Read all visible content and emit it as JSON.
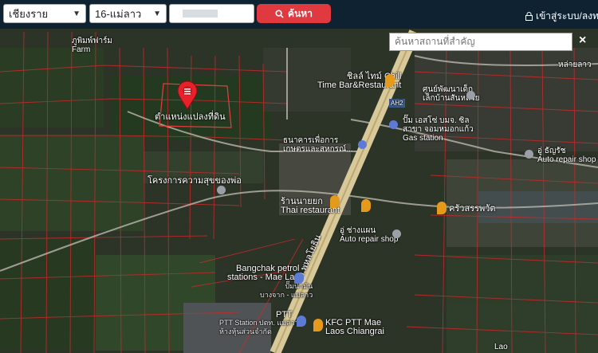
{
  "topbar": {
    "province": "เชียงราย",
    "district": "16-แม่ลาว",
    "parcel_value": "",
    "search_button": "ค้นหา",
    "login_label": "เข้าสู่ระบบ/ลงทะเ"
  },
  "map": {
    "place_search_placeholder": "ค้นหาสถานที่สำคัญ",
    "close_label": "×",
    "marker_label": "ตำแหน่งแปลงที่ดิน",
    "road_code": "AH2",
    "road_name": "ถ.พหลโยธิน",
    "places": [
      {
        "text": "ภูพิมพ์ฟาร์ม",
        "sub": "Farm"
      },
      {
        "text": "ชิลล์ ไทม์ Chill",
        "sub": "Time Bar&Restaurant"
      },
      {
        "text": "หล่ายลาว",
        "sub": ""
      },
      {
        "text": "ศูนย์พัฒนาเด็ก",
        "sub": "เล็กบ้านสันหลวย"
      },
      {
        "text": "ปั๊ม เอสโซ่ บมจ. ซิล",
        "sub": "สาขา จอมหมอกแก้ว"
      },
      {
        "text": "Gas station",
        "sub": ""
      },
      {
        "text": "ธนาคารเพื่อการ",
        "sub": "เกษตรและสหกรณ์..."
      },
      {
        "text": "อู่ ธัญรัช",
        "sub": "Auto repair shop"
      },
      {
        "text": "โครงการความสุขของพ่อ",
        "sub": ""
      },
      {
        "text": "ร้านนายยก",
        "sub": "Thai restaurant"
      },
      {
        "text": "ครัวสรรพวัต",
        "sub": ""
      },
      {
        "text": "อู่ ช่างแผน",
        "sub": "Auto repair shop"
      },
      {
        "text": "Bangchak petrol",
        "sub": "stations - Mae Lao"
      },
      {
        "text": "ปั๊มน้ำมัน",
        "sub": "บางจาก - แม่ลาว"
      },
      {
        "text": "PTT",
        "sub": ""
      },
      {
        "text": "KFC PTT Mae",
        "sub": "Laos Chiangrai"
      },
      {
        "text": "PTT Station ปตท. แม่ลาว",
        "sub": "ห้างหุ้นส่วนจำกัด"
      },
      {
        "text": "Lao",
        "sub": ""
      }
    ]
  }
}
